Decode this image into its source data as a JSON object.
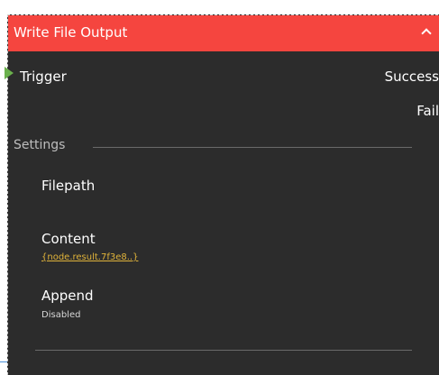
{
  "node": {
    "title": "Write File Output",
    "header_color": "#f5453f",
    "ports": {
      "input": "Trigger",
      "output_success": "Success",
      "output_fail": "Fail"
    },
    "settings": {
      "section_label": "Settings",
      "fields": [
        {
          "label": "Filepath",
          "value": ""
        },
        {
          "label": "Content",
          "value": "{node.result.7f3e8..}"
        },
        {
          "label": "Append",
          "value": "Disabled"
        }
      ]
    }
  },
  "icons": {
    "collapse": "chevron-up-icon",
    "input_port": "triangle-port-icon"
  }
}
